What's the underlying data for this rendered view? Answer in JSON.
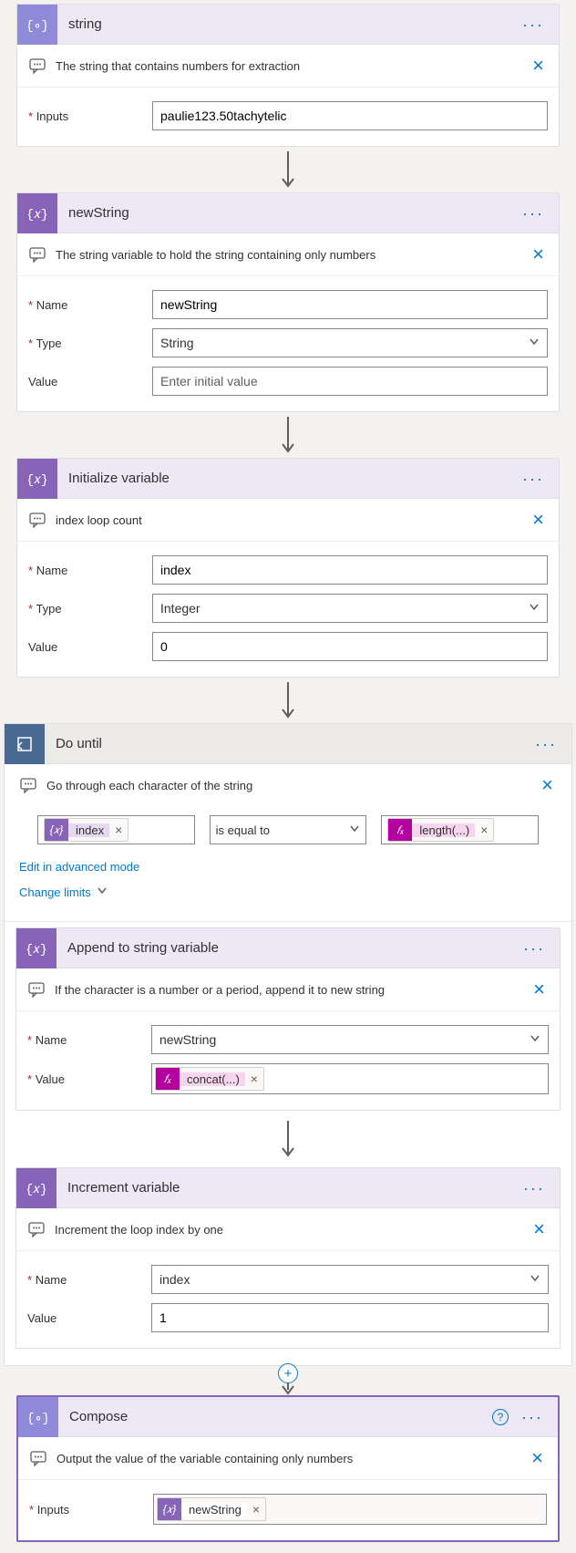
{
  "card1": {
    "title": "string",
    "comment": "The string that contains numbers for extraction",
    "inputs_label": "Inputs",
    "inputs_value": "paulie123.50tachytelic"
  },
  "card2": {
    "title": "newString",
    "comment": "The string variable to hold the string containing only numbers",
    "name_label": "Name",
    "name_value": "newString",
    "type_label": "Type",
    "type_value": "String",
    "value_label": "Value",
    "value_placeholder": "Enter initial value"
  },
  "card3": {
    "title": "Initialize variable",
    "comment": "index loop count",
    "name_label": "Name",
    "name_value": "index",
    "type_label": "Type",
    "type_value": "Integer",
    "value_label": "Value",
    "value_value": "0"
  },
  "doUntil": {
    "title": "Do until",
    "comment": "Go through each character of the string",
    "left_token": "index",
    "operator": "is equal to",
    "right_token": "length(...)",
    "advanced_link": "Edit in advanced mode",
    "change_limits": "Change limits"
  },
  "append": {
    "title": "Append to string variable",
    "comment": "If the character is a number or a period, append it to new string",
    "name_label": "Name",
    "name_value": "newString",
    "value_label": "Value",
    "value_token": "concat(...)"
  },
  "increment": {
    "title": "Increment variable",
    "comment": "Increment the loop index by one",
    "name_label": "Name",
    "name_value": "index",
    "value_label": "Value",
    "value_value": "1"
  },
  "compose": {
    "title": "Compose",
    "comment": "Output the value of the variable containing only numbers",
    "inputs_label": "Inputs",
    "inputs_token": "newString"
  }
}
